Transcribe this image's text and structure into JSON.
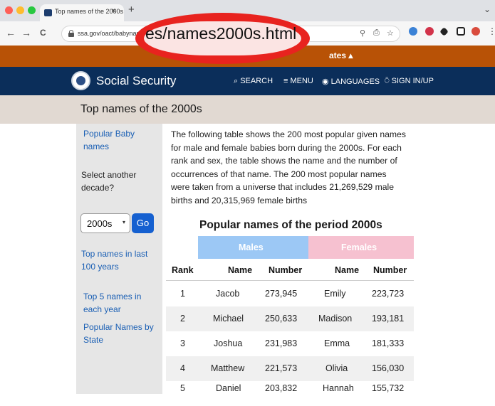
{
  "browser": {
    "tab_title": "Top names of the 2000s",
    "tab_close": "×",
    "new_tab": "+",
    "url_small": "ssa.gov/oact/babynames/de",
    "url_zoom": "es/names2000s.html",
    "nav_back": "←",
    "nav_forward": "→",
    "nav_reload": "C",
    "traffic_colors": [
      "#fe5f57",
      "#febc2e",
      "#28c840"
    ]
  },
  "gov_banner": {
    "text": "ates ▴"
  },
  "header": {
    "site_title": "Social Security",
    "nav": {
      "search": "⌕ SEARCH",
      "menu": "≡ MENU",
      "languages": "◉ LANGUAGES",
      "signin": "⍥ SIGN IN/UP"
    }
  },
  "page": {
    "title": "Top names of the 2000s"
  },
  "sidebar": {
    "popular_baby_names": "Popular Baby names",
    "select_label": "Select another decade?",
    "decade_value": "2000s",
    "go_label": "Go",
    "top_names_100": "Top names in last 100 years",
    "top5_each_year": "Top 5 names in each year",
    "by_state": "Popular Names by State"
  },
  "main": {
    "intro": "The following table shows the 200 most popular given names for male and female babies born during the 2000s. For each rank and sex, the table shows the name and the number of occurrences of that name. The 200 most popular names were taken from a universe that includes 21,269,529 male births and 20,315,969 female births",
    "table_title": "Popular names of the period 2000s",
    "males_label": "Males",
    "females_label": "Females",
    "headers": {
      "rank": "Rank",
      "male_name": "Name",
      "male_number": "Number",
      "female_name": "Name",
      "female_number": "Number"
    },
    "rows": [
      {
        "rank": "1",
        "male": "Jacob",
        "male_num": "273,945",
        "female": "Emily",
        "female_num": "223,723"
      },
      {
        "rank": "2",
        "male": "Michael",
        "male_num": "250,633",
        "female": "Madison",
        "female_num": "193,181"
      },
      {
        "rank": "3",
        "male": "Joshua",
        "male_num": "231,983",
        "female": "Emma",
        "female_num": "181,333"
      },
      {
        "rank": "4",
        "male": "Matthew",
        "male_num": "221,573",
        "female": "Olivia",
        "female_num": "156,030"
      },
      {
        "rank": "5",
        "male": "Daniel",
        "male_num": "203,832",
        "female": "Hannah",
        "female_num": "155,732"
      }
    ]
  }
}
